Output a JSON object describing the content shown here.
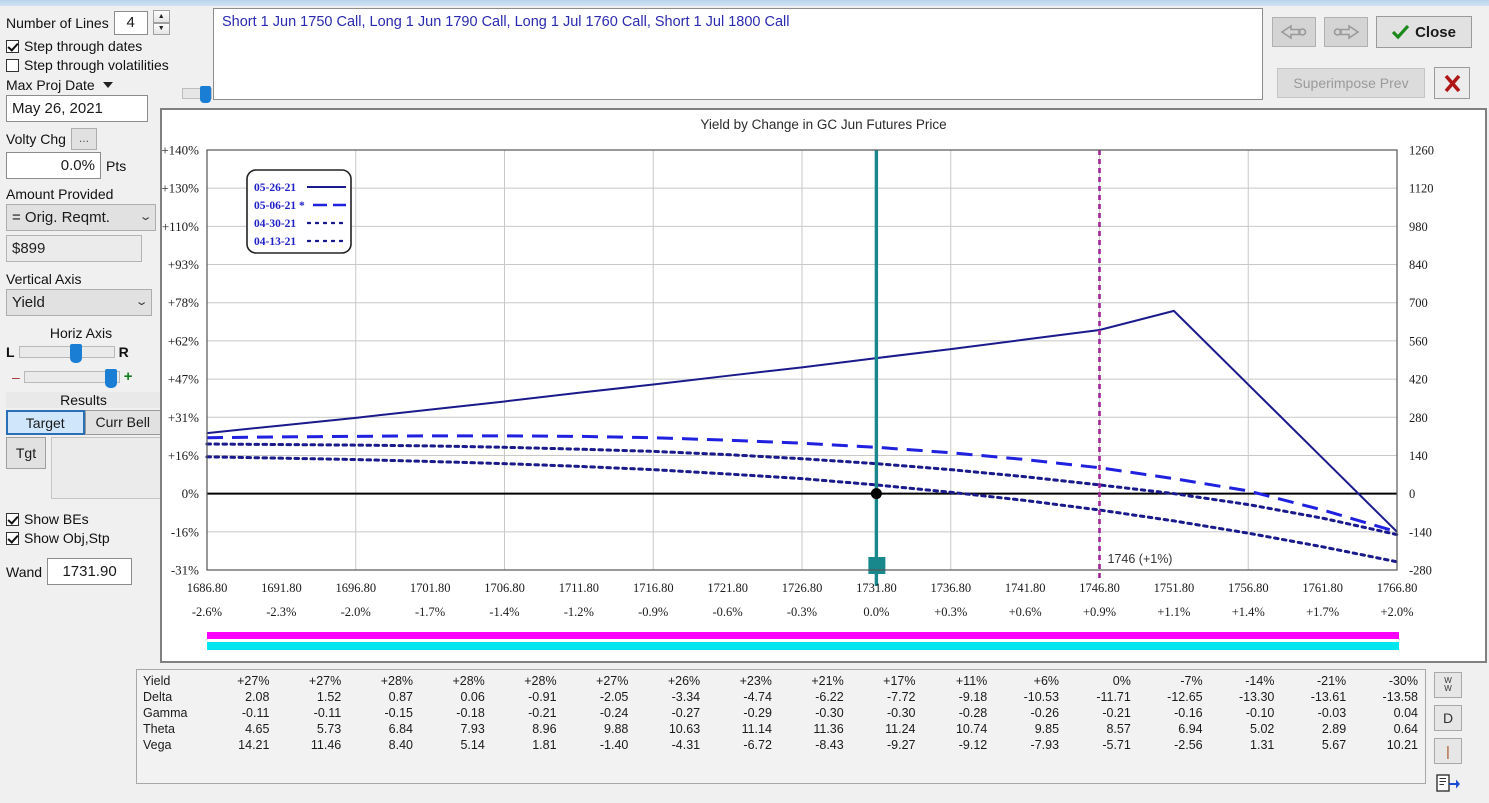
{
  "position_description": "Short 1 Jun 1750 Call, Long 1 Jun 1790 Call, Long 1 Jul 1760 Call, Short 1 Jul 1800 Call",
  "controls": {
    "number_of_lines_label": "Number of Lines",
    "number_of_lines_value": "4",
    "step_through_dates_label": "Step through dates",
    "step_through_dates_checked": true,
    "step_through_volatilities_label": "Step through volatilities",
    "step_through_volatilities_checked": false,
    "max_proj_date_label": "Max Proj Date",
    "max_proj_date_value": "May 26, 2021",
    "volty_chg_label": "Volty Chg",
    "volty_chg_ellipsis": "...",
    "volty_chg_value": "0.0%",
    "volty_chg_units": "Pts",
    "amount_provided_label": "Amount Provided",
    "amount_provided_value": "= Orig. Reqmt.",
    "amount_value": "$899",
    "vertical_axis_label": "Vertical Axis",
    "vertical_axis_value": "Yield",
    "horiz_axis_label": "Horiz Axis",
    "horiz_left_label": "L",
    "horiz_right_label": "R",
    "zoom_minus_label": "–",
    "zoom_plus_label": "+",
    "results_label": "Results",
    "tab_target": "Target",
    "tab_curr_bell": "Curr Bell",
    "tgt_button": "Tgt",
    "show_bes_label": "Show BEs",
    "show_bes_checked": true,
    "show_objstp_label": "Show Obj,Stp",
    "show_objstp_checked": true,
    "wand_label": "Wand",
    "wand_value": "1731.90"
  },
  "toolbar": {
    "prev_label": "⇐",
    "next_label": "⇒",
    "close_label": "Close",
    "superimpose_label": "Superimpose Prev",
    "cancel_label": "✖"
  },
  "side_buttons": [
    {
      "name": "ww-button",
      "label": "W\nW"
    },
    {
      "name": "d-button",
      "label": "D"
    },
    {
      "name": "i-button",
      "label": "I"
    },
    {
      "name": "export-button",
      "label": ""
    }
  ],
  "chart_data": {
    "type": "line",
    "title": "Yield by Change in GC Jun Futures Price",
    "xlabel": "",
    "ylabel": "Yield",
    "grid": true,
    "legend_position": "top-left",
    "x_ticks": [
      "1686.80",
      "1691.80",
      "1696.80",
      "1701.80",
      "1706.80",
      "1711.80",
      "1716.80",
      "1721.80",
      "1726.80",
      "1731.80",
      "1736.80",
      "1741.80",
      "1746.80",
      "1751.80",
      "1756.80",
      "1761.80",
      "1766.80"
    ],
    "x_ticks_secondary": [
      "-2.6%",
      "-2.3%",
      "-2.0%",
      "-1.7%",
      "-1.4%",
      "-1.2%",
      "-0.9%",
      "-0.6%",
      "-0.3%",
      "0.0%",
      "+0.3%",
      "+0.6%",
      "+0.9%",
      "+1.1%",
      "+1.4%",
      "+1.7%",
      "+2.0%"
    ],
    "y_ticks_left": [
      "+140%",
      "+130%",
      "+110%",
      "+93%",
      "+78%",
      "+62%",
      "+47%",
      "+31%",
      "+16%",
      "0%",
      "-16%",
      "-31%"
    ],
    "y_ticks_right": [
      "1260",
      "1120",
      "980",
      "840",
      "700",
      "560",
      "420",
      "280",
      "140",
      "0",
      "-140",
      "-280"
    ],
    "ylim_right": [
      -280,
      1260
    ],
    "legend": [
      {
        "label": "05-26-21",
        "style": "solid",
        "color": "#1a1a8c"
      },
      {
        "label": "05-06-21 *",
        "style": "long-dash",
        "color": "#2020e0"
      },
      {
        "label": "04-30-21",
        "style": "dotted",
        "color": "#1a1a8c"
      },
      {
        "label": "04-13-21",
        "style": "dotted",
        "color": "#1a1a8c"
      }
    ],
    "series": [
      {
        "name": "05-26-21",
        "style": "solid",
        "color": "#1a1a8c",
        "values": [
          222,
          250,
          278,
          308,
          338,
          370,
          400,
          432,
          463,
          497,
          530,
          565,
          600,
          670,
          400,
          130,
          -140
        ]
      },
      {
        "name": "05-06-21 *",
        "style": "long-dash",
        "color": "#2020e0",
        "values": [
          205,
          208,
          210,
          212,
          212,
          210,
          205,
          196,
          185,
          170,
          150,
          125,
          95,
          55,
          10,
          -60,
          -140
        ]
      },
      {
        "name": "04-30-21",
        "style": "dotted",
        "color": "#1a1a8c",
        "values": [
          182,
          180,
          178,
          175,
          170,
          163,
          155,
          143,
          128,
          110,
          88,
          62,
          32,
          0,
          -40,
          -90,
          -150
        ]
      },
      {
        "name": "04-13-21",
        "style": "dotted",
        "color": "#1a1a8c",
        "values": [
          135,
          130,
          125,
          118,
          110,
          100,
          88,
          72,
          55,
          32,
          5,
          -25,
          -60,
          -100,
          -145,
          -195,
          -250
        ]
      }
    ],
    "cursor": {
      "x_label": "1731.80",
      "value_label": "1731.90",
      "color": "#18888c"
    },
    "marker_line": {
      "label": "1746 (+1%)",
      "x": "1746.80",
      "color": "#a0249a"
    },
    "zero_line_color": "#000000",
    "bar_magenta_color": "#ff00ff",
    "bar_cyan_color": "#00e5ee"
  },
  "table": {
    "rows": [
      {
        "label": "Yield",
        "values": [
          "+27%",
          "+27%",
          "+28%",
          "+28%",
          "+28%",
          "+27%",
          "+26%",
          "+23%",
          "+21%",
          "+17%",
          "+11%",
          "+6%",
          "0%",
          "-7%",
          "-14%",
          "-21%",
          "-30%"
        ]
      },
      {
        "label": "Delta",
        "values": [
          "2.08",
          "1.52",
          "0.87",
          "0.06",
          "-0.91",
          "-2.05",
          "-3.34",
          "-4.74",
          "-6.22",
          "-7.72",
          "-9.18",
          "-10.53",
          "-11.71",
          "-12.65",
          "-13.30",
          "-13.61",
          "-13.58"
        ]
      },
      {
        "label": "Gamma",
        "values": [
          "-0.11",
          "-0.11",
          "-0.15",
          "-0.18",
          "-0.21",
          "-0.24",
          "-0.27",
          "-0.29",
          "-0.30",
          "-0.30",
          "-0.28",
          "-0.26",
          "-0.21",
          "-0.16",
          "-0.10",
          "-0.03",
          "0.04"
        ]
      },
      {
        "label": "Theta",
        "values": [
          "4.65",
          "5.73",
          "6.84",
          "7.93",
          "8.96",
          "9.88",
          "10.63",
          "11.14",
          "11.36",
          "11.24",
          "10.74",
          "9.85",
          "8.57",
          "6.94",
          "5.02",
          "2.89",
          "0.64"
        ]
      },
      {
        "label": "Vega",
        "values": [
          "14.21",
          "11.46",
          "8.40",
          "5.14",
          "1.81",
          "-1.40",
          "-4.31",
          "-6.72",
          "-8.43",
          "-9.27",
          "-9.12",
          "-7.93",
          "-5.71",
          "-2.56",
          "1.31",
          "5.67",
          "10.21"
        ]
      }
    ]
  }
}
